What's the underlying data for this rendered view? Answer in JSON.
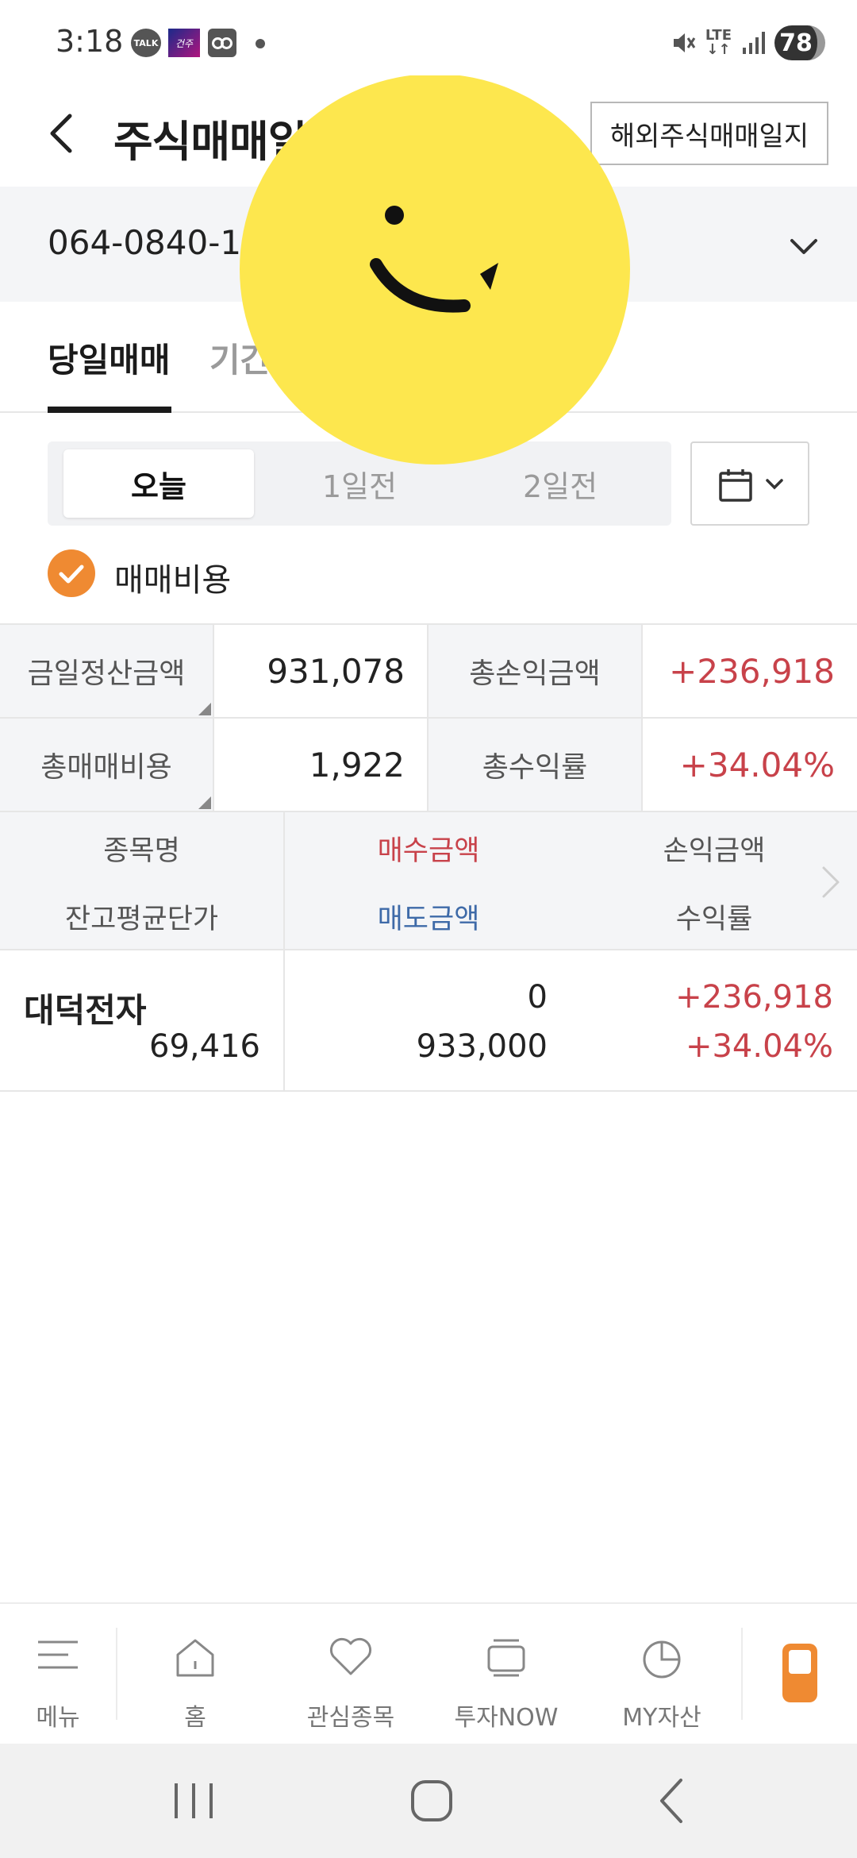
{
  "status_bar": {
    "time": "3:18",
    "talk_badge": "TALK",
    "app_badge": "건주",
    "battery": "78",
    "network": "LTE",
    "icons": [
      "mute-icon",
      "lte-icon",
      "signal-icon",
      "battery-icon"
    ]
  },
  "header": {
    "title": "주식매매일",
    "overseas_button": "해외주식매매일지"
  },
  "account": {
    "number": "064-0840-15"
  },
  "tabs": [
    {
      "label": "당일매매"
    },
    {
      "label": "기간"
    }
  ],
  "day_options": [
    {
      "label": "오늘",
      "active": true
    },
    {
      "label": "1일전",
      "active": false
    },
    {
      "label": "2일전",
      "active": false
    }
  ],
  "fee_checkbox": {
    "label": "매매비용",
    "checked": true
  },
  "summary": {
    "settle_label": "금일정산금액",
    "settle_value": "931,078",
    "pnl_label": "총손익금액",
    "pnl_value": "+236,918",
    "fee_label": "총매매비용",
    "fee_value": "1,922",
    "rate_label": "총수익률",
    "rate_value": "+34.04%"
  },
  "table": {
    "headers": {
      "name": "종목명",
      "avg_price": "잔고평균단가",
      "buy_amount": "매수금액",
      "sell_amount": "매도금액",
      "pnl": "손익금액",
      "rate": "수익률"
    },
    "rows": [
      {
        "name": "대덕전자",
        "avg_price": "69,416",
        "buy_amount": "0",
        "sell_amount": "933,000",
        "pnl": "+236,918",
        "rate": "+34.04%"
      }
    ]
  },
  "bottom_nav": [
    {
      "label": "메뉴",
      "icon": "menu-icon"
    },
    {
      "label": "홈",
      "icon": "home-icon"
    },
    {
      "label": "관심종목",
      "icon": "heart-icon"
    },
    {
      "label": "투자NOW",
      "icon": "stack-icon"
    },
    {
      "label": "MY자산",
      "icon": "pie-chart-icon"
    }
  ],
  "colors": {
    "accent": "#ef8a32",
    "positive": "#c8424a",
    "sell": "#3e6aa8",
    "sticker": "#fde74e"
  }
}
